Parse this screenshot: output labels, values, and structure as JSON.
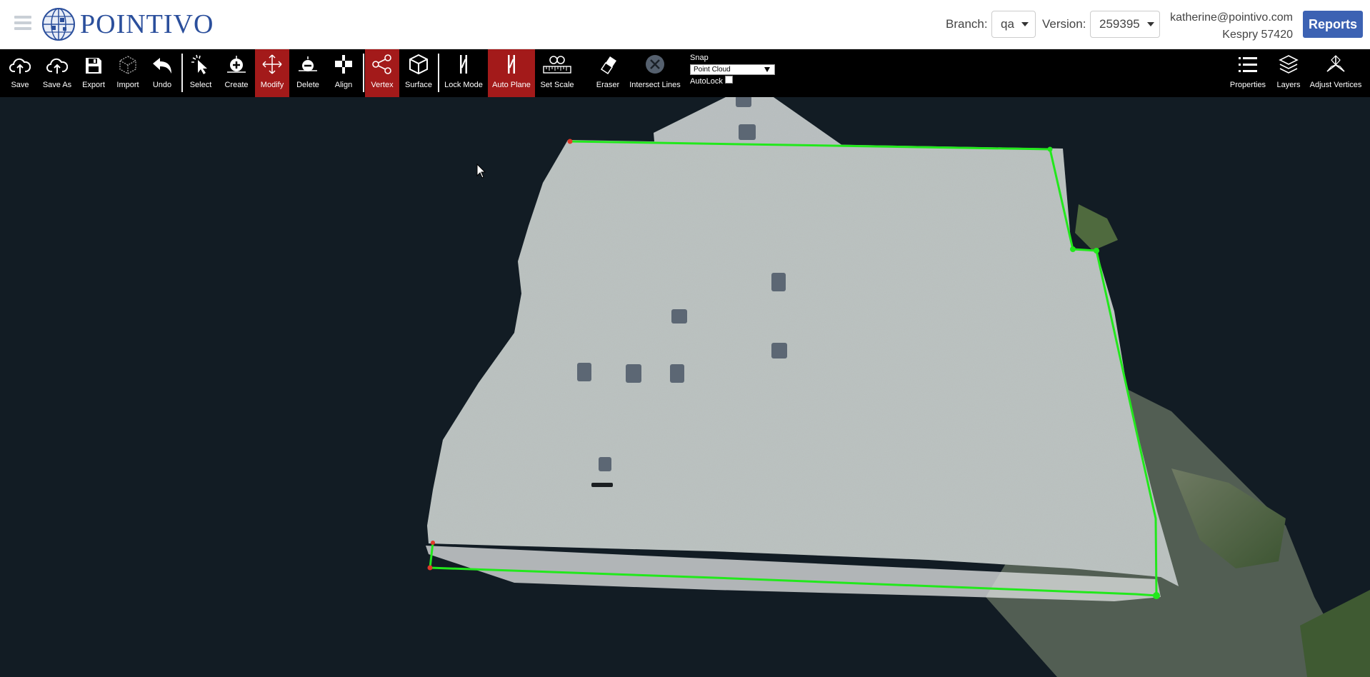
{
  "app": {
    "logo_text": "POINTIVO",
    "logo_icon": "globe-icon",
    "menu_icon": "list-icon"
  },
  "header": {
    "branch_label": "Branch:",
    "branch_value": "qa",
    "version_label": "Version:",
    "version_value": "259395",
    "user_email": "katherine@pointivo.com",
    "user_company": "Kespry 57420",
    "reports_label": "Reports",
    "accent_color": "#3c62b3"
  },
  "toolbar": {
    "save": "Save",
    "save_as": "Save As",
    "export": "Export",
    "import": "Import",
    "undo": "Undo",
    "select": "Select",
    "create": "Create",
    "modify": "Modify",
    "delete": "Delete",
    "align": "Align",
    "vertex": "Vertex",
    "surface": "Surface",
    "lock_mode": "Lock Mode",
    "auto_plane": "Auto Plane",
    "set_scale": "Set Scale",
    "eraser": "Eraser",
    "intersect_lines": "Intersect Lines",
    "properties": "Properties",
    "layers": "Layers",
    "adjust_vertices": "Adjust Vertices",
    "active_tools": [
      "Modify",
      "Vertex",
      "Auto Plane"
    ],
    "active_color": "#a31a1a",
    "snap": {
      "title": "Snap",
      "value": "Point Cloud",
      "autolock_label": "AutoLock",
      "autolock_checked": false
    }
  },
  "viewport": {
    "background_color": "#121c24",
    "outline_color": "#22e81c",
    "vertex_color": "#e03a2a"
  }
}
